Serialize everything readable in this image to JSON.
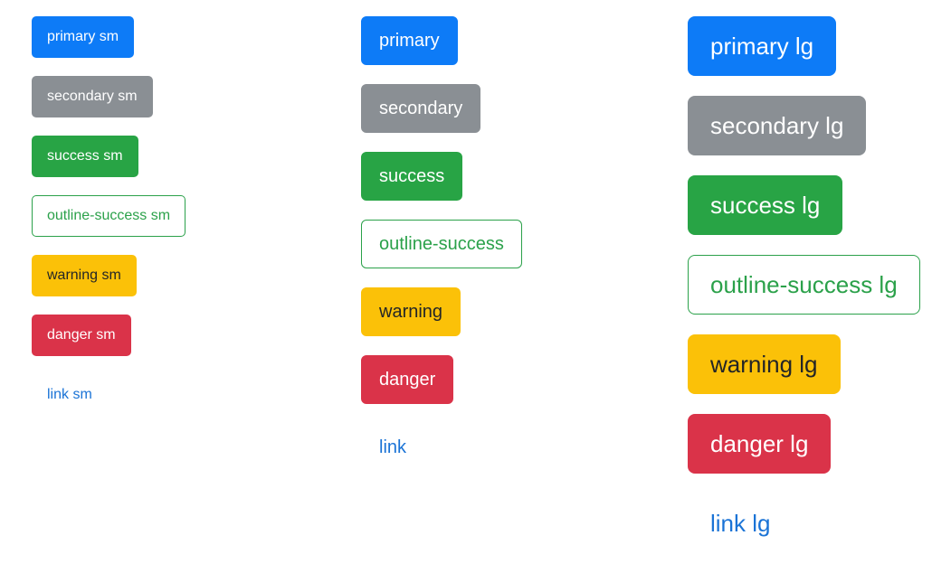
{
  "page": {
    "title": "Button Variants Showcase",
    "background": "#ffffff"
  },
  "palette": {
    "primary": "#0d7bf7",
    "secondary": "#8a8f94",
    "success": "#28a445",
    "outline_success_border": "#2ba14a",
    "outline_success_text": "#2ba14a",
    "warning": "#fbc108",
    "warning_text": "#232527",
    "danger": "#da3349",
    "link": "#1a73d6",
    "on_dark_text": "#ffffff"
  },
  "columns": [
    {
      "key": "small",
      "size_label": "sm",
      "buttons": [
        {
          "variant": "primary",
          "label": "primary sm"
        },
        {
          "variant": "secondary",
          "label": "secondary sm"
        },
        {
          "variant": "success",
          "label": "success sm"
        },
        {
          "variant": "outline-success",
          "label": "outline-success sm"
        },
        {
          "variant": "warning",
          "label": "warning sm"
        },
        {
          "variant": "danger",
          "label": "danger sm"
        },
        {
          "variant": "link",
          "label": "link sm"
        }
      ]
    },
    {
      "key": "medium",
      "size_label": "",
      "buttons": [
        {
          "variant": "primary",
          "label": "primary"
        },
        {
          "variant": "secondary",
          "label": "secondary"
        },
        {
          "variant": "success",
          "label": "success"
        },
        {
          "variant": "outline-success",
          "label": "outline-success"
        },
        {
          "variant": "warning",
          "label": "warning"
        },
        {
          "variant": "danger",
          "label": "danger"
        },
        {
          "variant": "link",
          "label": "link"
        }
      ]
    },
    {
      "key": "large",
      "size_label": "lg",
      "buttons": [
        {
          "variant": "primary",
          "label": "primary lg"
        },
        {
          "variant": "secondary",
          "label": "secondary lg"
        },
        {
          "variant": "success",
          "label": "success lg"
        },
        {
          "variant": "outline-success",
          "label": "outline-success lg"
        },
        {
          "variant": "warning",
          "label": "warning lg"
        },
        {
          "variant": "danger",
          "label": "danger lg"
        },
        {
          "variant": "link",
          "label": "link lg"
        }
      ]
    }
  ]
}
